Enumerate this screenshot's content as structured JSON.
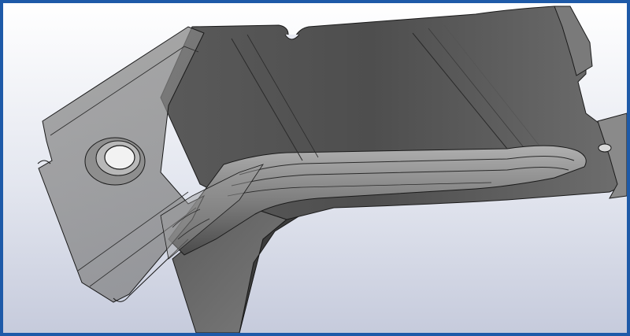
{
  "viewport": {
    "border_color": "#1e5aa8",
    "background_top": "#ffffff",
    "background_bottom": "#c9cfe0",
    "model_color_opaque": "#6a6a6a",
    "model_color_transparent": "#9a9a9a",
    "edge_color": "#1a1a1a",
    "model_icon": "sheet-metal-bracket-icon"
  }
}
